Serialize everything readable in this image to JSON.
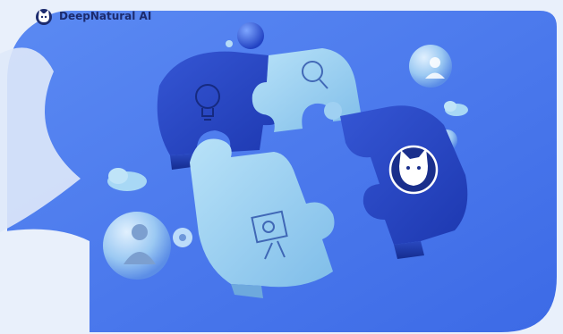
{
  "brand": {
    "name": "DeepNatural AI",
    "logo_icon": "cat-face-logo-icon"
  },
  "illustration": {
    "subject": "puzzle-pieces-illustration",
    "piece_icons": [
      "lightbulb-icon",
      "magnifier-icon",
      "presentation-board-icon",
      "cat-face-icon"
    ],
    "bubble_icons": [
      "person-avatar-icon",
      "person-avatar-icon",
      "gear-icon"
    ]
  },
  "colors": {
    "background_blue": "#4f7df0",
    "deep_blue": "#2446c7",
    "light_blue": "#9fd0f2",
    "brand_text": "#1c2b6e"
  }
}
